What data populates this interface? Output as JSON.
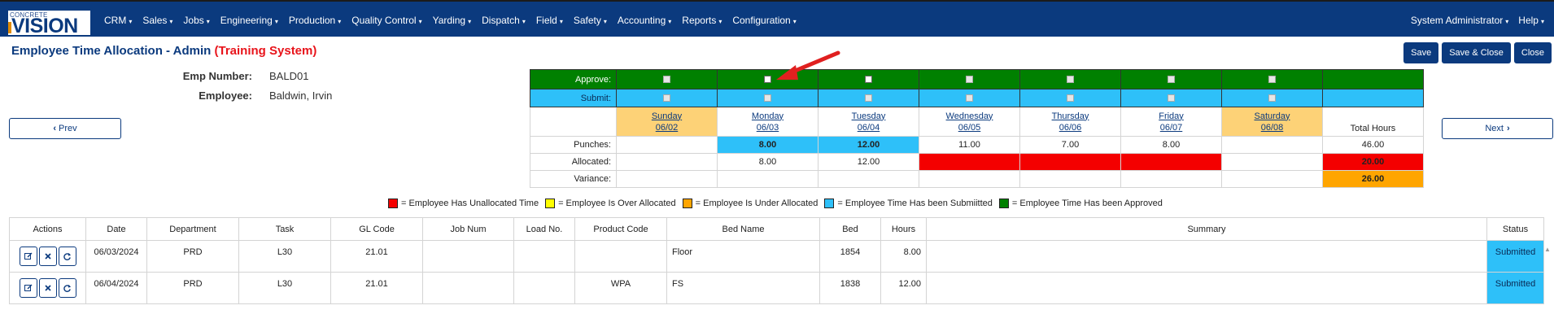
{
  "brand": {
    "logo_small": "CONCRETE",
    "logo_big": "VISION"
  },
  "nav": {
    "items": [
      "CRM",
      "Sales",
      "Jobs",
      "Engineering",
      "Production",
      "Quality Control",
      "Yarding",
      "Dispatch",
      "Field",
      "Safety",
      "Accounting",
      "Reports",
      "Configuration"
    ],
    "right": [
      "System Administrator",
      "Help"
    ]
  },
  "page": {
    "title": "Employee Time Allocation - Admin",
    "training": "(Training System)"
  },
  "buttons": {
    "save": "Save",
    "save_close": "Save & Close",
    "close": "Close",
    "prev": "Prev",
    "next": "Next"
  },
  "employee": {
    "num_label": "Emp Number:",
    "num": "BALD01",
    "name_label": "Employee:",
    "name": "Baldwin, Irvin"
  },
  "grid": {
    "labels": {
      "approve": "Approve:",
      "submit": "Submit:",
      "punches": "Punches:",
      "allocated": "Allocated:",
      "variance": "Variance:",
      "total": "Total Hours"
    },
    "days": [
      {
        "name": "Sunday",
        "date": "06/02",
        "punch": "",
        "alloc": "",
        "weekend": true
      },
      {
        "name": "Monday",
        "date": "06/03",
        "punch": "8.00",
        "alloc": "8.00",
        "weekend": false
      },
      {
        "name": "Tuesday",
        "date": "06/04",
        "punch": "12.00",
        "alloc": "12.00",
        "weekend": false
      },
      {
        "name": "Wednesday",
        "date": "06/05",
        "punch": "11.00",
        "alloc": "",
        "weekend": false
      },
      {
        "name": "Thursday",
        "date": "06/06",
        "punch": "7.00",
        "alloc": "",
        "weekend": false
      },
      {
        "name": "Friday",
        "date": "06/07",
        "punch": "8.00",
        "alloc": "",
        "weekend": false
      },
      {
        "name": "Saturday",
        "date": "06/08",
        "punch": "",
        "alloc": "",
        "weekend": true
      }
    ],
    "totals": {
      "punches": "46.00",
      "allocated": "20.00",
      "variance": "26.00"
    }
  },
  "legend": [
    {
      "color": "#f40000",
      "text": "= Employee Has Unallocated Time"
    },
    {
      "color": "#ffff00",
      "text": "= Employee Is Over Allocated"
    },
    {
      "color": "#ffa500",
      "text": "= Employee Is Under Allocated"
    },
    {
      "color": "#2ec0f9",
      "text": "= Employee Time Has been Submiitted"
    },
    {
      "color": "#008000",
      "text": "= Employee Time Has been Approved"
    }
  ],
  "table": {
    "headers": [
      "Actions",
      "Date",
      "Department",
      "Task",
      "GL Code",
      "Job Num",
      "Load No.",
      "Product Code",
      "Bed Name",
      "Bed",
      "Hours",
      "Summary",
      "Status"
    ],
    "rows": [
      {
        "date": "06/03/2024",
        "department": "PRD",
        "task": "L30",
        "gl": "21.01",
        "job": "",
        "load": "",
        "product": "",
        "bed_name": "Floor",
        "bed": "1854",
        "hours": "8.00",
        "summary": "",
        "status": "Submitted"
      },
      {
        "date": "06/04/2024",
        "department": "PRD",
        "task": "L30",
        "gl": "21.01",
        "job": "",
        "load": "",
        "product": "WPA",
        "bed_name": "FS",
        "bed": "1838",
        "hours": "12.00",
        "summary": "",
        "status": "Submitted"
      }
    ]
  }
}
